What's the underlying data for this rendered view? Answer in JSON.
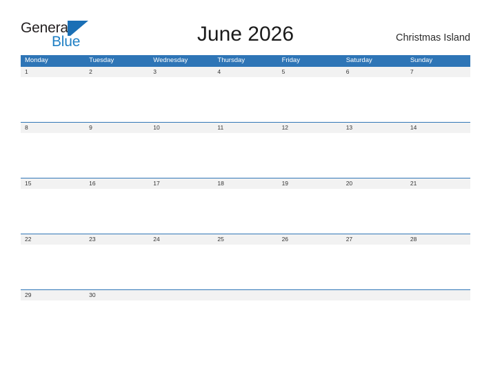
{
  "brand": {
    "name_part1": "General",
    "name_part2": "Blue",
    "mark": "triangle-flag",
    "color_dark": "#231f20",
    "color_blue": "#1f7fc4"
  },
  "header": {
    "title": "June 2026",
    "location": "Christmas Island"
  },
  "theme": {
    "header_blue": "#2e75b6",
    "band_gray": "#f2f2f2",
    "page_background": "#ffffff"
  },
  "calendar": {
    "month": "June",
    "year": "2026",
    "weekday_headers": [
      "Monday",
      "Tuesday",
      "Wednesday",
      "Thursday",
      "Friday",
      "Saturday",
      "Sunday"
    ],
    "weeks": [
      {
        "days": [
          "1",
          "2",
          "3",
          "4",
          "5",
          "6",
          "7"
        ]
      },
      {
        "days": [
          "8",
          "9",
          "10",
          "11",
          "12",
          "13",
          "14"
        ]
      },
      {
        "days": [
          "15",
          "16",
          "17",
          "18",
          "19",
          "20",
          "21"
        ]
      },
      {
        "days": [
          "22",
          "23",
          "24",
          "25",
          "26",
          "27",
          "28"
        ]
      },
      {
        "days": [
          "29",
          "30",
          "",
          "",
          "",
          "",
          ""
        ]
      }
    ]
  }
}
